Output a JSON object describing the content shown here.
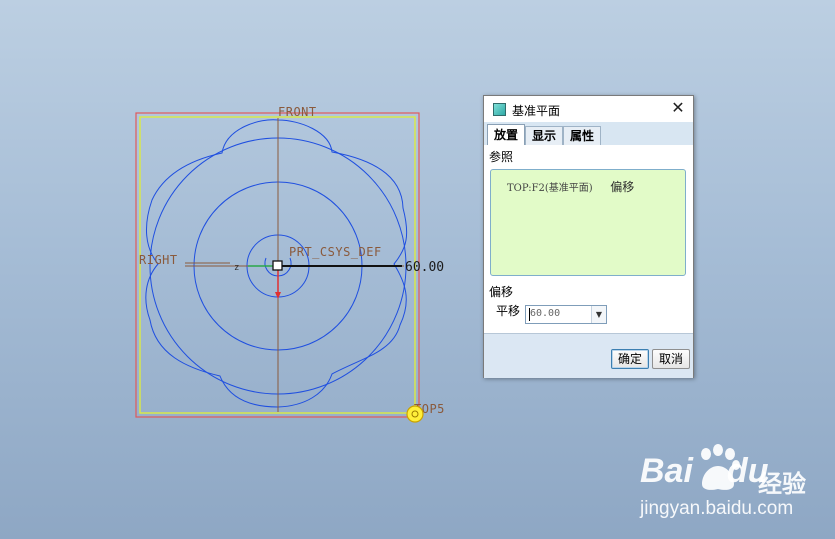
{
  "viewport": {
    "labels": {
      "front": "FRONT",
      "right": "RIGHT",
      "csys": "PRT_CSYS_DEF",
      "top": "TOP5",
      "dimension": "60.00"
    },
    "colors": {
      "sketch_curve": "#1f4fe0",
      "datum_frame": "#d9534f",
      "preview_frame": "#d8e84a",
      "axis": "#8a5a3c",
      "drag_handle": "#ffef3a"
    }
  },
  "dialog": {
    "title": "基准平面",
    "tabs": [
      {
        "label": "放置",
        "active": true
      },
      {
        "label": "显示",
        "active": false
      },
      {
        "label": "属性",
        "active": false
      }
    ],
    "references_label": "参照",
    "references": [
      {
        "ref": "TOP:F2(基准平面)",
        "constraint": "偏移"
      }
    ],
    "offset_section_label": "偏移",
    "translate_label": "平移",
    "translate_value": "60.00",
    "ok_label": "确定",
    "cancel_label": "取消"
  },
  "watermark": {
    "brand": "Bai",
    "brand_suffix": "du",
    "cn": "经验",
    "url": "jingyan.baidu.com"
  }
}
